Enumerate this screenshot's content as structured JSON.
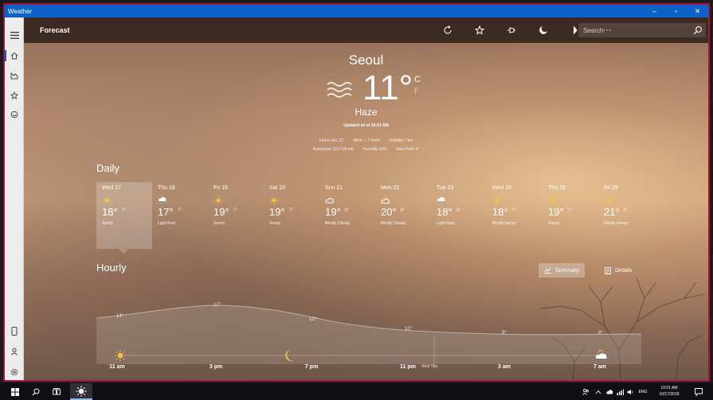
{
  "window": {
    "title": "Weather",
    "minimize": "–",
    "maximize": "▫",
    "close": "✕"
  },
  "toolbar": {
    "heading": "Forecast",
    "more": "···"
  },
  "search": {
    "placeholder": "Search"
  },
  "current": {
    "city": "Seoul",
    "temp": "11°",
    "unit_c": "C",
    "unit_f": "F",
    "condition": "Haze",
    "updated": "Updated as of 10:01 AM",
    "feels_like": "Feels Like 11°",
    "wind": "Wind ↗ 7 km/h",
    "visibility": "Visibility 7 km",
    "barometer": "Barometer 1017.00 mb",
    "humidity": "Humidity 63%",
    "dew_point": "Dew Point 4°"
  },
  "daily": {
    "title": "Daily",
    "days": [
      {
        "name": "Wed 17",
        "hi": "18°",
        "lo": "7°",
        "cond": "Sunny",
        "icon": "sun-icon"
      },
      {
        "name": "Thu 18",
        "hi": "17°",
        "lo": "7°",
        "cond": "Light Rain",
        "icon": "rain-icon"
      },
      {
        "name": "Fri 19",
        "hi": "19°",
        "lo": "7°",
        "cond": "Sunny",
        "icon": "sun-icon"
      },
      {
        "name": "Sat 20",
        "hi": "19°",
        "lo": "7°",
        "cond": "Sunny",
        "icon": "sun-icon"
      },
      {
        "name": "Sun 21",
        "hi": "19°",
        "lo": "8°",
        "cond": "Mostly Cloudy",
        "icon": "cloud-icon"
      },
      {
        "name": "Mon 22",
        "hi": "20°",
        "lo": "8°",
        "cond": "Mostly Cloudy",
        "icon": "partly-cloudy-icon"
      },
      {
        "name": "Tue 23",
        "hi": "18°",
        "lo": "9°",
        "cond": "Light Rain",
        "icon": "rain-icon"
      },
      {
        "name": "Wed 24",
        "hi": "18°",
        "lo": "7°",
        "cond": "Mostly Sunny",
        "icon": "sun-icon"
      },
      {
        "name": "Thu 25",
        "hi": "19°",
        "lo": "7°",
        "cond": "Sunny",
        "icon": "sun-icon"
      },
      {
        "name": "Fri 26",
        "hi": "21°",
        "lo": "8°",
        "cond": "Mostly Sunny",
        "icon": "sun-icon"
      }
    ]
  },
  "hourly": {
    "title": "Hourly",
    "summary_label": "Summary",
    "details_label": "Details",
    "day_divider": "Wed Thu",
    "times": [
      "11 am",
      "3 pm",
      "7 pm",
      "11 pm",
      "3 am",
      "7 am"
    ],
    "temps": [
      "14°",
      "17°",
      "13°",
      "10°",
      "9°",
      "9°"
    ]
  },
  "taskbar": {
    "lang": "ENG",
    "time": "10:01 AM",
    "date": "10/17/2018"
  },
  "colors": {
    "accent": "#0b62c8",
    "window_border": "#a8123c",
    "sun": "#f5c342"
  }
}
